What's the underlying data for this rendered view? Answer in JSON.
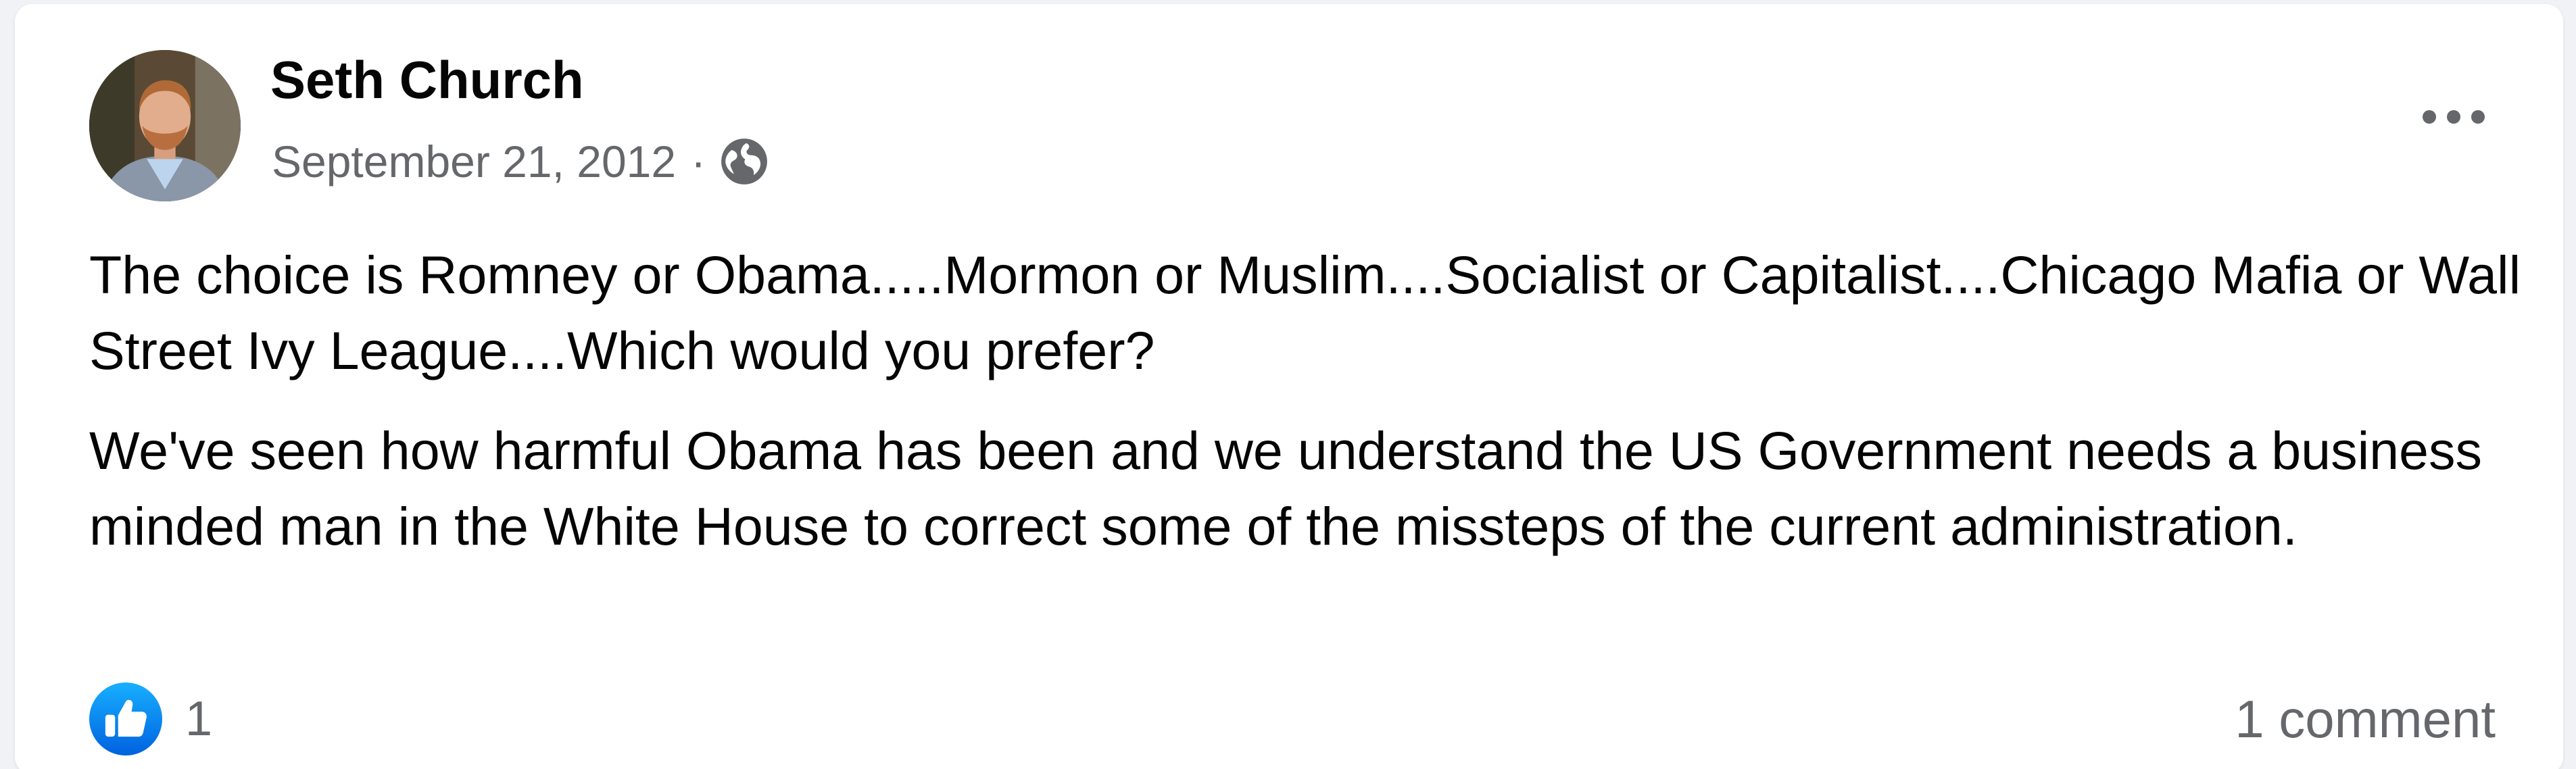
{
  "post": {
    "author": "Seth Church",
    "date": "September 21, 2012",
    "separator": "·",
    "privacy_icon": "globe-icon",
    "more_icon": "more-horizontal-icon",
    "paragraphs": [
      "The choice is Romney or Obama.....Mormon or Muslim....Socialist or Capitalist....Chicago Mafia or Wall Street Ivy League....Which would you prefer?",
      "We've seen how harmful Obama has been and we understand the US Government needs a business minded man in the White House to correct some of the missteps of the current administration."
    ],
    "reactions": {
      "icon": "like-icon",
      "count": "1"
    },
    "comments_label": "1 comment"
  },
  "colors": {
    "accent": "#1877f2",
    "text_primary": "#050505",
    "text_secondary": "#65676b",
    "background": "#f0f2f5",
    "card": "#ffffff"
  }
}
